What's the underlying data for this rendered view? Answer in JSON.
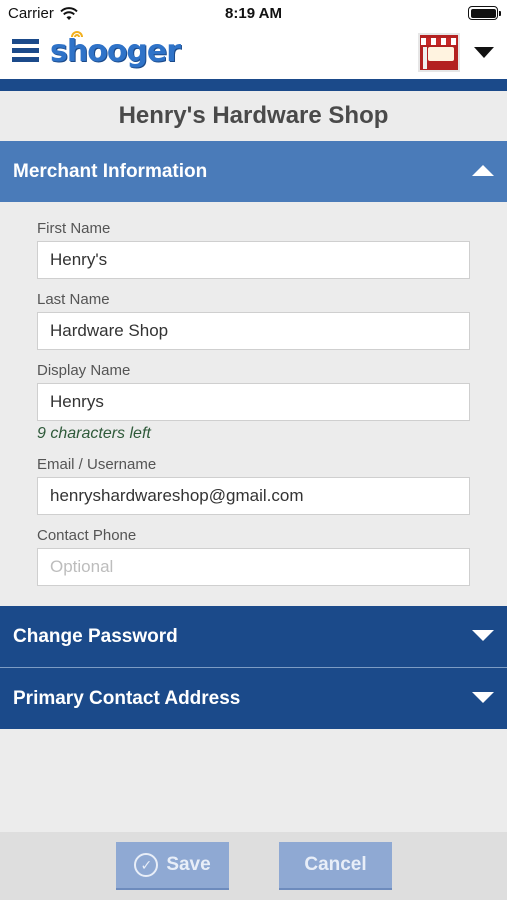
{
  "status_bar": {
    "carrier": "Carrier",
    "time": "8:19 AM"
  },
  "header": {
    "logo_text": "shooger",
    "brand_color": "#1b4a8a",
    "accent_color": "#4a7bb9"
  },
  "page": {
    "title": "Henry's Hardware Shop"
  },
  "sections": {
    "merchant": {
      "label": "Merchant Information",
      "expanded": true
    },
    "password": {
      "label": "Change Password",
      "expanded": false
    },
    "address": {
      "label": "Primary Contact Address",
      "expanded": false
    }
  },
  "form": {
    "first_name": {
      "label": "First Name",
      "value": "Henry's"
    },
    "last_name": {
      "label": "Last Name",
      "value": "Hardware Shop"
    },
    "display_name": {
      "label": "Display Name",
      "value": "Henrys",
      "hint": "9 characters left"
    },
    "email": {
      "label": "Email / Username",
      "value": "henryshardwareshop@gmail.com"
    },
    "phone": {
      "label": "Contact Phone",
      "value": "",
      "placeholder": "Optional"
    }
  },
  "footer": {
    "save_label": "Save",
    "cancel_label": "Cancel"
  }
}
